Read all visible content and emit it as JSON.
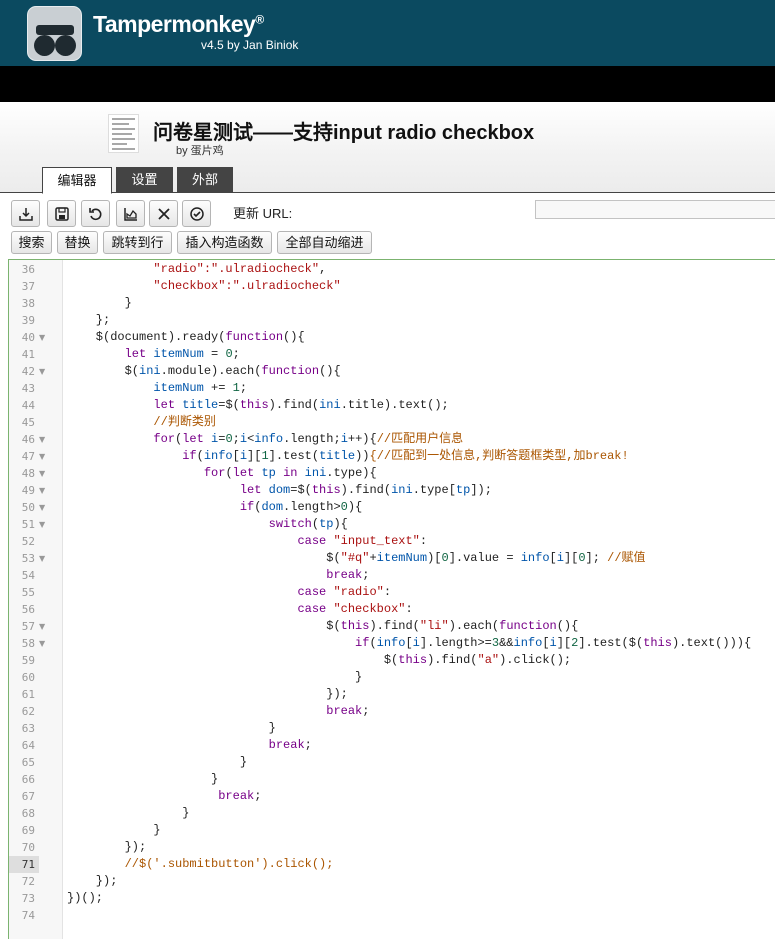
{
  "header": {
    "app_name": "Tampermonkey",
    "trademark": "®",
    "version": "v4.5 by Jan Biniok"
  },
  "script": {
    "title": "问卷星测试——支持input radio checkbox",
    "author": "by 蛋片鸡"
  },
  "tabs": [
    {
      "label": "编辑器",
      "active": true
    },
    {
      "label": "设置",
      "active": false
    },
    {
      "label": "外部",
      "active": false
    }
  ],
  "toolbar": {
    "icons": [
      "save-to-disk-icon",
      "save-icon",
      "undo-icon",
      "chart-icon",
      "close-icon",
      "check-icon"
    ],
    "update_url_label": "更新 URL:",
    "update_url_value": ""
  },
  "toolbar2": [
    "搜索",
    "替换",
    "跳转到行",
    "插入构造函数",
    "全部自动缩进"
  ],
  "editor": {
    "active_line": 71,
    "lines": [
      {
        "n": 36,
        "fold": false,
        "tokens": [
          [
            "            ",
            ""
          ],
          [
            "\"radio\":\".ulradiocheck\"",
            "st"
          ],
          [
            ",",
            ""
          ]
        ]
      },
      {
        "n": 37,
        "fold": false,
        "tokens": [
          [
            "            ",
            ""
          ],
          [
            "\"checkbox\":\".ulradiocheck\"",
            "st"
          ]
        ]
      },
      {
        "n": 38,
        "fold": false,
        "tokens": [
          [
            "        }",
            ""
          ]
        ]
      },
      {
        "n": 39,
        "fold": false,
        "tokens": [
          [
            "    };",
            ""
          ]
        ]
      },
      {
        "n": 40,
        "fold": true,
        "tokens": [
          [
            "    $(document).ready(",
            ""
          ],
          [
            "function",
            "kw"
          ],
          [
            "(){",
            ""
          ]
        ]
      },
      {
        "n": 41,
        "fold": false,
        "tokens": [
          [
            "        ",
            ""
          ],
          [
            "let",
            "kw"
          ],
          [
            " ",
            ""
          ],
          [
            "itemNum",
            "vr"
          ],
          [
            " = ",
            ""
          ],
          [
            "0",
            "nm"
          ],
          [
            ";",
            ""
          ]
        ]
      },
      {
        "n": 42,
        "fold": true,
        "tokens": [
          [
            "        $(",
            ""
          ],
          [
            "ini",
            "vr"
          ],
          [
            ".module).each(",
            ""
          ],
          [
            "function",
            "kw"
          ],
          [
            "(){",
            ""
          ]
        ]
      },
      {
        "n": 43,
        "fold": false,
        "tokens": [
          [
            "            ",
            ""
          ],
          [
            "itemNum",
            "vr"
          ],
          [
            " += ",
            ""
          ],
          [
            "1",
            "nm"
          ],
          [
            ";",
            ""
          ]
        ]
      },
      {
        "n": 44,
        "fold": false,
        "tokens": [
          [
            "            ",
            ""
          ],
          [
            "let",
            "kw"
          ],
          [
            " ",
            ""
          ],
          [
            "title",
            "vr"
          ],
          [
            "=$(",
            ""
          ],
          [
            "this",
            "kw"
          ],
          [
            ").find(",
            ""
          ],
          [
            "ini",
            "vr"
          ],
          [
            ".title).text();",
            ""
          ]
        ]
      },
      {
        "n": 45,
        "fold": false,
        "tokens": [
          [
            "            ",
            ""
          ],
          [
            "//判断类别",
            "cm"
          ]
        ]
      },
      {
        "n": 46,
        "fold": true,
        "tokens": [
          [
            "            ",
            ""
          ],
          [
            "for",
            "kw"
          ],
          [
            "(",
            ""
          ],
          [
            "let",
            "kw"
          ],
          [
            " ",
            ""
          ],
          [
            "i",
            "vr"
          ],
          [
            "=",
            ""
          ],
          [
            "0",
            "nm"
          ],
          [
            ";",
            ""
          ],
          [
            "i",
            "vr"
          ],
          [
            "<",
            ""
          ],
          [
            "info",
            "vr"
          ],
          [
            ".length;",
            ""
          ],
          [
            "i",
            "vr"
          ],
          [
            "++){",
            ""
          ],
          [
            "//匹配用户信息",
            "cm"
          ]
        ]
      },
      {
        "n": 47,
        "fold": true,
        "tokens": [
          [
            "                ",
            ""
          ],
          [
            "if",
            "kw"
          ],
          [
            "(",
            ""
          ],
          [
            "info",
            "vr"
          ],
          [
            "[",
            ""
          ],
          [
            "i",
            "vr"
          ],
          [
            "][",
            ""
          ],
          [
            "1",
            "nm"
          ],
          [
            "].test(",
            ""
          ],
          [
            "title",
            "vr"
          ],
          [
            "))",
            ""
          ],
          [
            "{//匹配到一处信息,判断答题框类型,加break!",
            "cm"
          ]
        ]
      },
      {
        "n": 48,
        "fold": true,
        "tokens": [
          [
            "                   ",
            ""
          ],
          [
            "for",
            "kw"
          ],
          [
            "(",
            ""
          ],
          [
            "let",
            "kw"
          ],
          [
            " ",
            ""
          ],
          [
            "tp",
            "vr"
          ],
          [
            " ",
            ""
          ],
          [
            "in",
            "kw"
          ],
          [
            " ",
            ""
          ],
          [
            "ini",
            "vr"
          ],
          [
            ".type){",
            ""
          ]
        ]
      },
      {
        "n": 49,
        "fold": true,
        "tokens": [
          [
            "                        ",
            ""
          ],
          [
            "let",
            "kw"
          ],
          [
            " ",
            ""
          ],
          [
            "dom",
            "vr"
          ],
          [
            "=$(",
            ""
          ],
          [
            "this",
            "kw"
          ],
          [
            ").find(",
            ""
          ],
          [
            "ini",
            "vr"
          ],
          [
            ".type[",
            ""
          ],
          [
            "tp",
            "vr"
          ],
          [
            "]);",
            ""
          ]
        ]
      },
      {
        "n": 50,
        "fold": true,
        "tokens": [
          [
            "                        ",
            ""
          ],
          [
            "if",
            "kw"
          ],
          [
            "(",
            ""
          ],
          [
            "dom",
            "vr"
          ],
          [
            ".length>",
            ""
          ],
          [
            "0",
            "nm"
          ],
          [
            "){",
            ""
          ]
        ]
      },
      {
        "n": 51,
        "fold": true,
        "tokens": [
          [
            "                            ",
            ""
          ],
          [
            "switch",
            "kw"
          ],
          [
            "(",
            ""
          ],
          [
            "tp",
            "vr"
          ],
          [
            "){",
            ""
          ]
        ]
      },
      {
        "n": 52,
        "fold": false,
        "tokens": [
          [
            "                                ",
            ""
          ],
          [
            "case",
            "kw"
          ],
          [
            " ",
            ""
          ],
          [
            "\"input_text\"",
            "st"
          ],
          [
            ":",
            ""
          ]
        ]
      },
      {
        "n": 53,
        "fold": true,
        "tokens": [
          [
            "                                    $(",
            ""
          ],
          [
            "\"#q\"",
            "st"
          ],
          [
            "+",
            ""
          ],
          [
            "itemNum",
            "vr"
          ],
          [
            ")[",
            ""
          ],
          [
            "0",
            "nm"
          ],
          [
            "].value = ",
            ""
          ],
          [
            "info",
            "vr"
          ],
          [
            "[",
            ""
          ],
          [
            "i",
            "vr"
          ],
          [
            "][",
            ""
          ],
          [
            "0",
            "nm"
          ],
          [
            "]; ",
            ""
          ],
          [
            "//赋值",
            "cm"
          ]
        ]
      },
      {
        "n": 54,
        "fold": false,
        "tokens": [
          [
            "                                    ",
            ""
          ],
          [
            "break",
            "kw"
          ],
          [
            ";",
            ""
          ]
        ]
      },
      {
        "n": 55,
        "fold": false,
        "tokens": [
          [
            "                                ",
            ""
          ],
          [
            "case",
            "kw"
          ],
          [
            " ",
            ""
          ],
          [
            "\"radio\"",
            "st"
          ],
          [
            ":",
            ""
          ]
        ]
      },
      {
        "n": 56,
        "fold": false,
        "tokens": [
          [
            "                                ",
            ""
          ],
          [
            "case",
            "kw"
          ],
          [
            " ",
            ""
          ],
          [
            "\"checkbox\"",
            "st"
          ],
          [
            ":",
            ""
          ]
        ]
      },
      {
        "n": 57,
        "fold": true,
        "tokens": [
          [
            "                                    $(",
            ""
          ],
          [
            "this",
            "kw"
          ],
          [
            ").find(",
            ""
          ],
          [
            "\"li\"",
            "st"
          ],
          [
            ").each(",
            ""
          ],
          [
            "function",
            "kw"
          ],
          [
            "(){",
            ""
          ]
        ]
      },
      {
        "n": 58,
        "fold": true,
        "tokens": [
          [
            "                                        ",
            ""
          ],
          [
            "if",
            "kw"
          ],
          [
            "(",
            ""
          ],
          [
            "info",
            "vr"
          ],
          [
            "[",
            ""
          ],
          [
            "i",
            "vr"
          ],
          [
            "].length>=",
            ""
          ],
          [
            "3",
            "nm"
          ],
          [
            "&&",
            ""
          ],
          [
            "info",
            "vr"
          ],
          [
            "[",
            ""
          ],
          [
            "i",
            "vr"
          ],
          [
            "][",
            ""
          ],
          [
            "2",
            "nm"
          ],
          [
            "].test($(",
            ""
          ],
          [
            "this",
            "kw"
          ],
          [
            ").text())){",
            ""
          ]
        ]
      },
      {
        "n": 59,
        "fold": false,
        "tokens": [
          [
            "                                            $(",
            ""
          ],
          [
            "this",
            "kw"
          ],
          [
            ").find(",
            ""
          ],
          [
            "\"a\"",
            "st"
          ],
          [
            ").click();",
            ""
          ]
        ]
      },
      {
        "n": 60,
        "fold": false,
        "tokens": [
          [
            "                                        }",
            ""
          ]
        ]
      },
      {
        "n": 61,
        "fold": false,
        "tokens": [
          [
            "                                    });",
            ""
          ]
        ]
      },
      {
        "n": 62,
        "fold": false,
        "tokens": [
          [
            "                                    ",
            ""
          ],
          [
            "break",
            "kw"
          ],
          [
            ";",
            ""
          ]
        ]
      },
      {
        "n": 63,
        "fold": false,
        "tokens": [
          [
            "                            }",
            ""
          ]
        ]
      },
      {
        "n": 64,
        "fold": false,
        "tokens": [
          [
            "                            ",
            ""
          ],
          [
            "break",
            "kw"
          ],
          [
            ";",
            ""
          ]
        ]
      },
      {
        "n": 65,
        "fold": false,
        "tokens": [
          [
            "                        }",
            ""
          ]
        ]
      },
      {
        "n": 66,
        "fold": false,
        "tokens": [
          [
            "                    }",
            ""
          ]
        ]
      },
      {
        "n": 67,
        "fold": false,
        "tokens": [
          [
            "                     ",
            ""
          ],
          [
            "break",
            "kw"
          ],
          [
            ";",
            ""
          ]
        ]
      },
      {
        "n": 68,
        "fold": false,
        "tokens": [
          [
            "                }",
            ""
          ]
        ]
      },
      {
        "n": 69,
        "fold": false,
        "tokens": [
          [
            "            }",
            ""
          ]
        ]
      },
      {
        "n": 70,
        "fold": false,
        "tokens": [
          [
            "        });",
            ""
          ]
        ]
      },
      {
        "n": 71,
        "fold": false,
        "tokens": [
          [
            "        ",
            ""
          ],
          [
            "//$('.submitbutton').click();",
            "cm"
          ]
        ]
      },
      {
        "n": 72,
        "fold": false,
        "tokens": [
          [
            "    });",
            ""
          ]
        ]
      },
      {
        "n": 73,
        "fold": false,
        "tokens": [
          [
            "})();",
            ""
          ]
        ]
      },
      {
        "n": 74,
        "fold": false,
        "tokens": [
          [
            "",
            ""
          ]
        ]
      }
    ]
  }
}
